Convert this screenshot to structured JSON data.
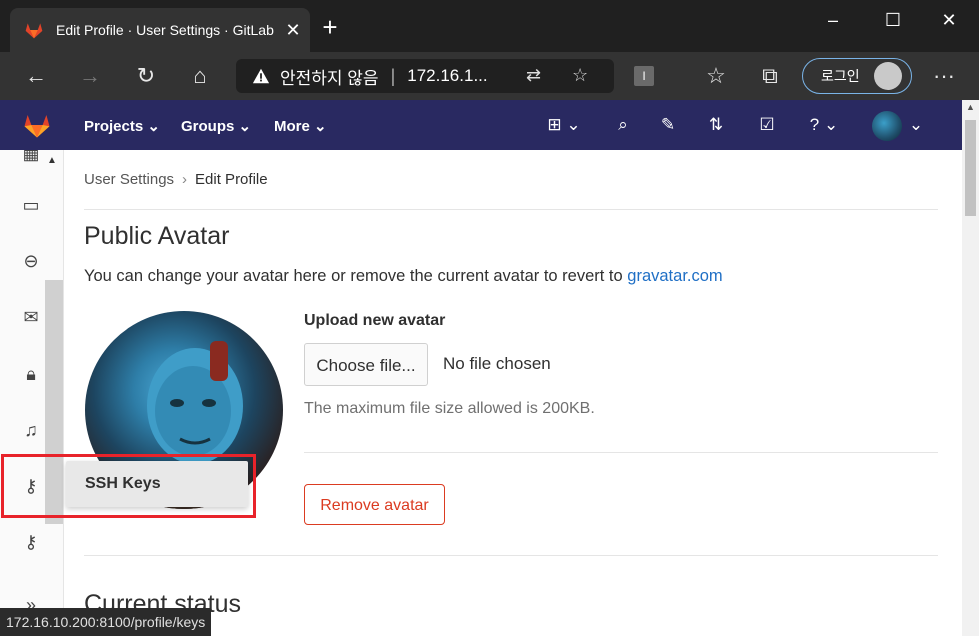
{
  "browser": {
    "tab_title": "Edit Profile · User Settings · GitLab",
    "security_warning": "안전하지 않음",
    "url_display": "172.16.1...",
    "login_label": "로그인"
  },
  "header": {
    "nav": [
      "Projects",
      "Groups",
      "More"
    ]
  },
  "breadcrumb": {
    "parent": "User Settings",
    "current": "Edit Profile"
  },
  "avatar_section": {
    "title": "Public Avatar",
    "description": "You can change your avatar here or remove the current avatar to revert to ",
    "link_text": "gravatar.com",
    "upload_label": "Upload new avatar",
    "choose_button": "Choose file...",
    "no_file": "No file chosen",
    "max_size": "The maximum file size allowed is 200KB.",
    "remove_button": "Remove avatar"
  },
  "status_section": {
    "title": "Current status"
  },
  "tooltip": {
    "text": "SSH Keys"
  },
  "statusbar": {
    "url": "172.16.10.200:8100/profile/keys"
  },
  "colors": {
    "gitlab_header": "#292961",
    "remove_red": "#db3b21",
    "link_blue": "#1f6fc5",
    "highlight_red": "#e8232a"
  }
}
